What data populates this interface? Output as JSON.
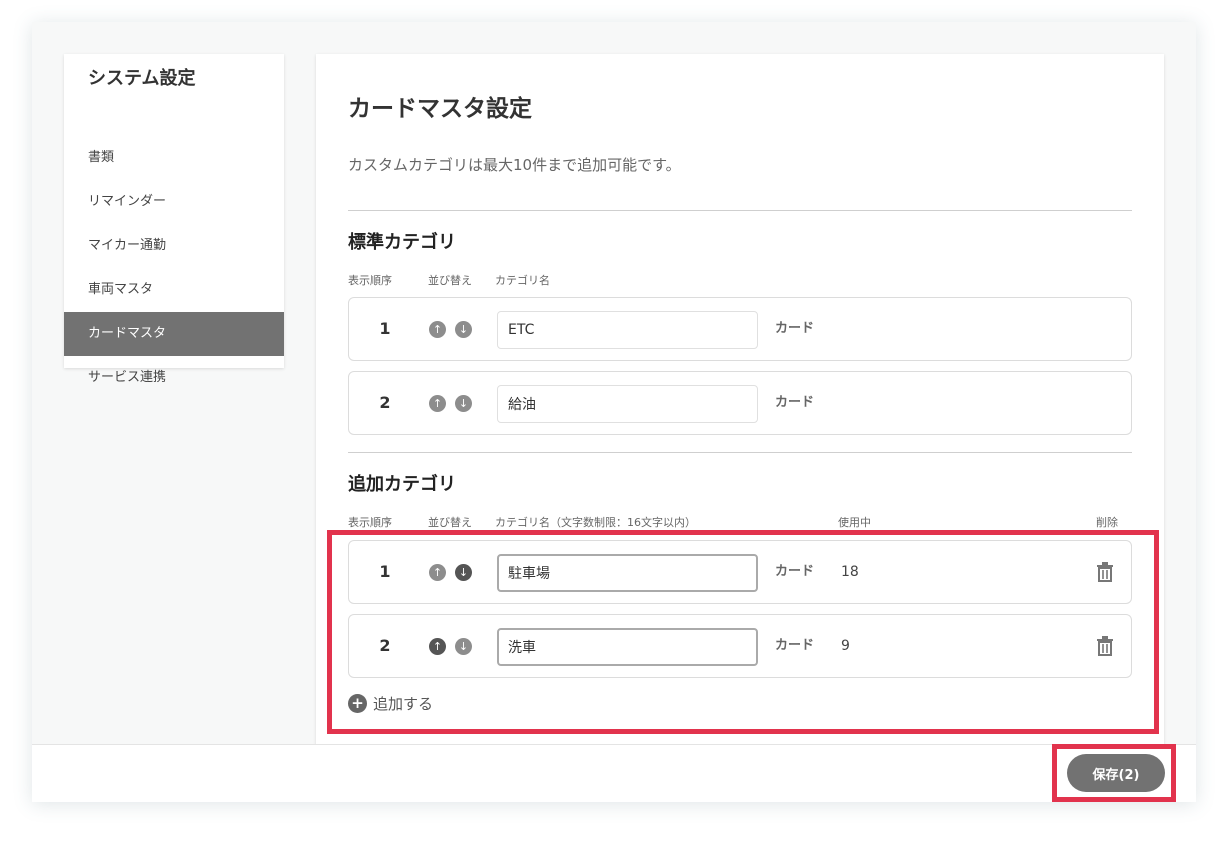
{
  "sidebar": {
    "title": "システム設定",
    "items": [
      {
        "label": "書類"
      },
      {
        "label": "リマインダー"
      },
      {
        "label": "マイカー通勤"
      },
      {
        "label": "車両マスタ"
      },
      {
        "label": "カードマスタ",
        "active": true
      },
      {
        "label": "サービス連携"
      }
    ]
  },
  "main": {
    "title": "カードマスタ設定",
    "description": "カスタムカテゴリは最大10件まで追加可能です。",
    "standard": {
      "title": "標準カテゴリ",
      "headers": {
        "order": "表示順序",
        "sort": "並び替え",
        "name": "カテゴリ名"
      },
      "rows": [
        {
          "order": "1",
          "name": "ETC",
          "suffix": "カード"
        },
        {
          "order": "2",
          "name": "給油",
          "suffix": "カード"
        }
      ]
    },
    "custom": {
      "title": "追加カテゴリ",
      "headers": {
        "order": "表示順序",
        "sort": "並び替え",
        "name": "カテゴリ名（文字数制限：16文字以内）",
        "in_use": "使用中",
        "delete": "削除"
      },
      "rows": [
        {
          "order": "1",
          "name": "駐車場",
          "suffix": "カード",
          "count": "18"
        },
        {
          "order": "2",
          "name": "洗車",
          "suffix": "カード",
          "count": "9"
        }
      ],
      "add_label": "追加する"
    }
  },
  "icons": {
    "up": "arrow-up-icon",
    "down": "arrow-down-icon",
    "trash": "trash-icon",
    "add": "plus-icon"
  },
  "colors": {
    "highlight": "#e2334d",
    "active_nav": "#727272",
    "save_button": "#727272"
  },
  "footer": {
    "save_label": "保存(2)"
  }
}
